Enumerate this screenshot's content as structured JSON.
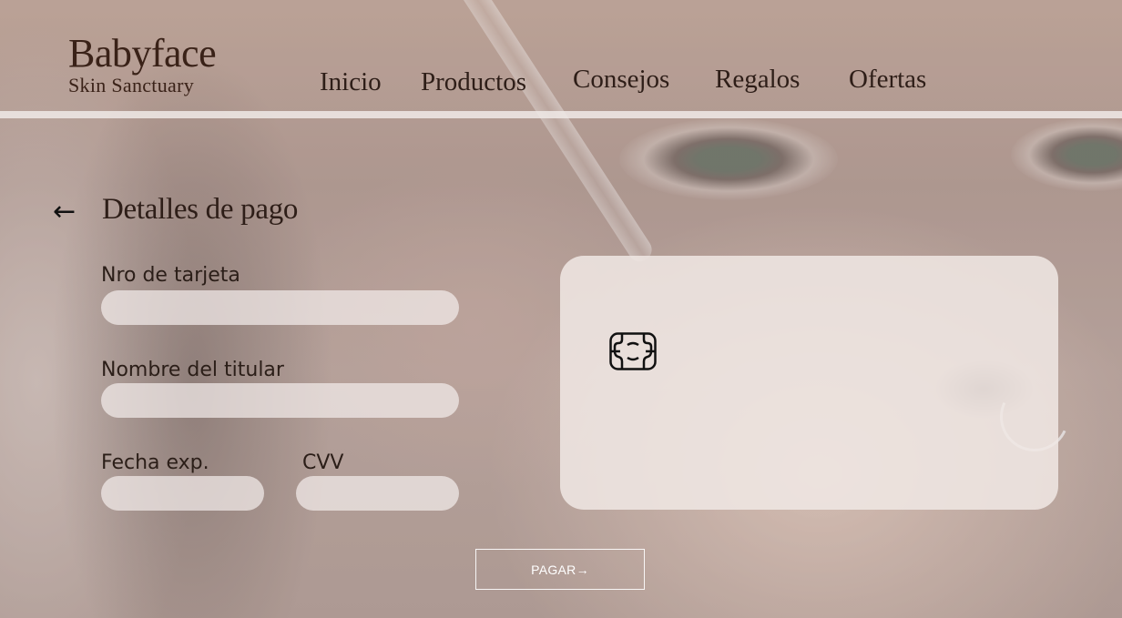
{
  "brand": {
    "name": "Babyface",
    "tagline": "Skin Sanctuary"
  },
  "nav": {
    "items": [
      {
        "label": "Inicio"
      },
      {
        "label": "Productos"
      },
      {
        "label": "Consejos"
      },
      {
        "label": "Regalos"
      },
      {
        "label": "Ofertas"
      }
    ]
  },
  "payment": {
    "back_icon": "left-arrow",
    "title": "Detalles de pago",
    "fields": {
      "card_number": {
        "label": "Nro de tarjeta",
        "value": ""
      },
      "holder_name": {
        "label": "Nombre del titular",
        "value": ""
      },
      "expiry": {
        "label": "Fecha exp.",
        "value": ""
      },
      "cvv": {
        "label": "CVV",
        "value": ""
      }
    },
    "card_preview": {
      "chip_icon": "card-chip"
    },
    "pay_button": {
      "label": "PAGAR→"
    }
  },
  "colors": {
    "text_dark": "#2e1e18",
    "input_bg": "#f2ecea",
    "card_bg": "#f0e8e4",
    "button_border": "#ffffff"
  }
}
